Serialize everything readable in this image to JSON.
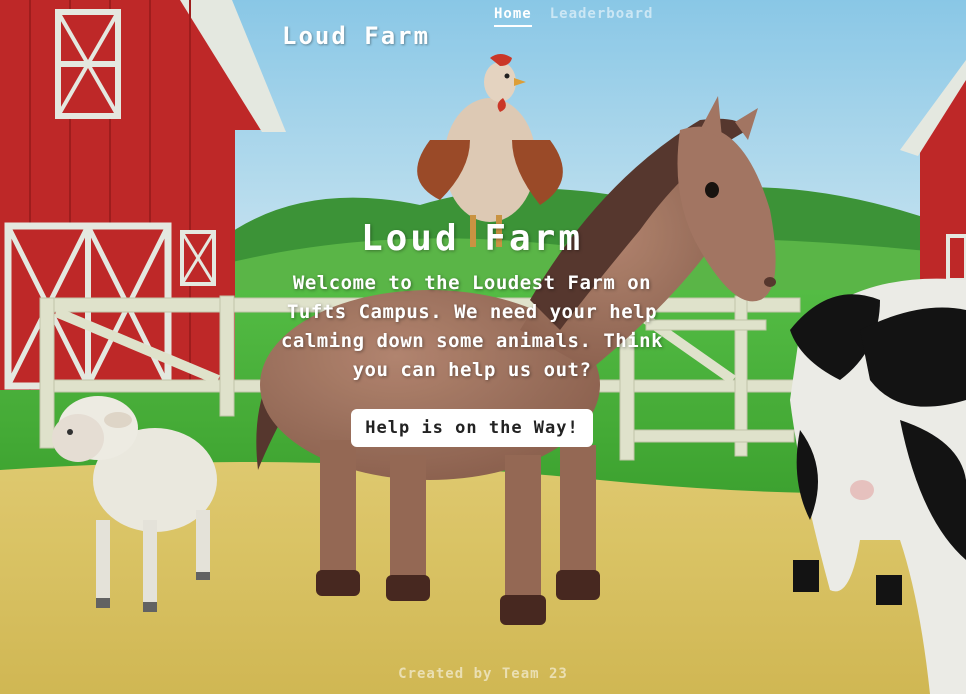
{
  "header": {
    "brand": "Loud Farm",
    "nav": {
      "home": "Home",
      "leaderboard": "Leaderboard"
    }
  },
  "hero": {
    "title": "Loud Farm",
    "lead": "Welcome to the Loudest Farm on Tufts Campus. We need your help calming down some animals. Think you can help us out?",
    "button_label": "Help is on the Way!"
  },
  "footer": {
    "text": "Created by Team 23"
  },
  "colors": {
    "sky": "#bfe6f7",
    "barn_red": "#c62a2a",
    "grass": "#4cbb3a",
    "dirt": "#e3cc68",
    "fence": "#e9ecd4"
  },
  "background_scene": [
    "barn-left",
    "barn-right",
    "fence",
    "rooster",
    "horse",
    "sheep",
    "cow"
  ]
}
